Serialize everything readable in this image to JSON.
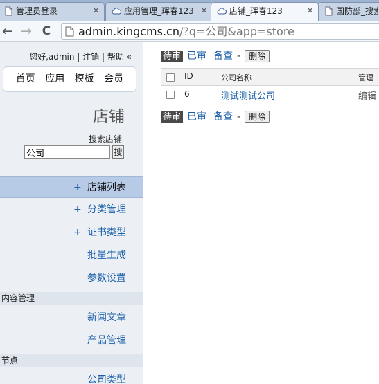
{
  "tabs": [
    {
      "label": "管理员登录",
      "close": "×",
      "icon": "page-icon"
    },
    {
      "label": "应用管理_珲春123",
      "close": "×",
      "icon": "cloud-icon"
    },
    {
      "label": "店铺_珲春123",
      "close": "×",
      "icon": "cloud-icon"
    },
    {
      "label": "国防部_搜索",
      "close": "",
      "icon": "page-icon"
    }
  ],
  "toolbar": {
    "back": "←",
    "forward": "→",
    "reload": "C",
    "url_host": "admin.kingcms.cn",
    "url_rest": "/?q=公司&app=store"
  },
  "sidebar": {
    "userbar": "您好,admin | 注销 | 帮助 «",
    "topnav": [
      "首页",
      "应用",
      "模板",
      "会员"
    ],
    "section_title": "店铺",
    "search": {
      "label": "搜索店铺",
      "value": "公司",
      "button": "搜"
    },
    "menu": [
      {
        "label": "店铺列表",
        "plus": "+"
      },
      {
        "label": "分类管理",
        "plus": "+"
      },
      {
        "label": "证书类型",
        "plus": "+"
      },
      {
        "label": "批量生成",
        "plus": ""
      },
      {
        "label": "参数设置",
        "plus": ""
      }
    ],
    "group_content": {
      "title": "内容管理",
      "items": [
        {
          "label": "新闻文章"
        },
        {
          "label": "产品管理"
        }
      ]
    },
    "group_node": {
      "title": "节点",
      "items": [
        {
          "label": "公司类型"
        }
      ]
    }
  },
  "main": {
    "actions_top": {
      "pending": "待审",
      "approved": "已审",
      "reserved": "备查",
      "dash": "-",
      "delete": "删除"
    },
    "actions_bottom": {
      "pending": "待审",
      "approved": "已审",
      "reserved": "备查",
      "dash": "-",
      "delete": "删除"
    },
    "table": {
      "headers": {
        "id": "ID",
        "name": "公司名称",
        "manage": "管理"
      },
      "rows": [
        {
          "id": "6",
          "name": "测试测试公司",
          "manage": "编辑"
        }
      ]
    }
  },
  "colors": {
    "accent_link": "#1a5fa8",
    "sidebar_bg": "#ecf0f5",
    "menu_active": "#b7cbe6"
  }
}
